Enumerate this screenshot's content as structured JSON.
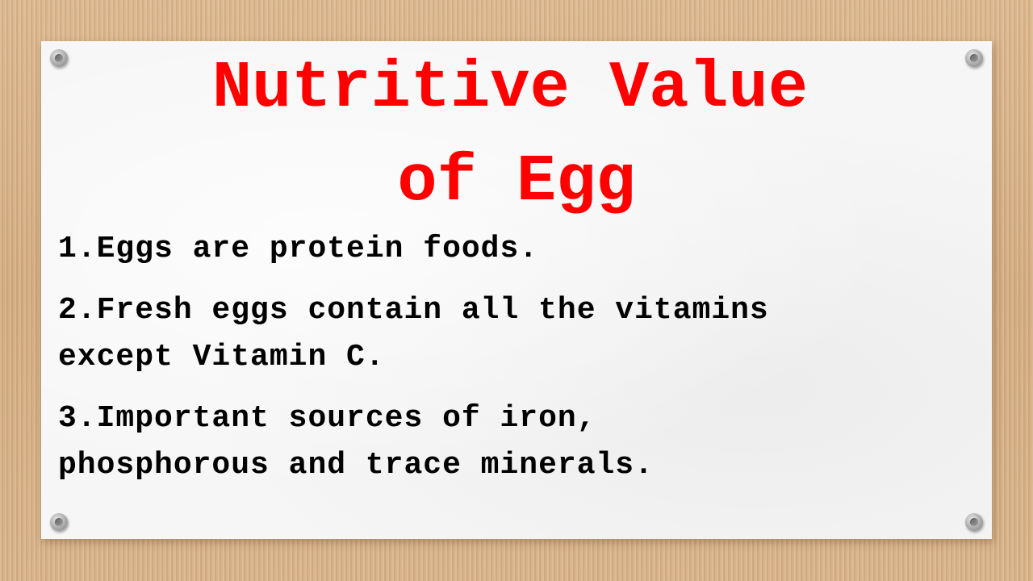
{
  "slide": {
    "title_line1": "Nutritive Value",
    "title_line2": "of Egg",
    "points": [
      {
        "line1": "1.Eggs are protein foods."
      },
      {
        "line1": "2.Fresh eggs contain all the vitamins",
        "line2": "except Vitamin C."
      },
      {
        "line1": "3.Important sources of iron,",
        "line2": "phosphorous and trace minerals."
      }
    ]
  },
  "colors": {
    "title": "#ff0000",
    "body_text": "#000000",
    "paper": "#f6f6f6",
    "background": "#d9b48a"
  },
  "icons": [
    "pushpin-icon"
  ]
}
